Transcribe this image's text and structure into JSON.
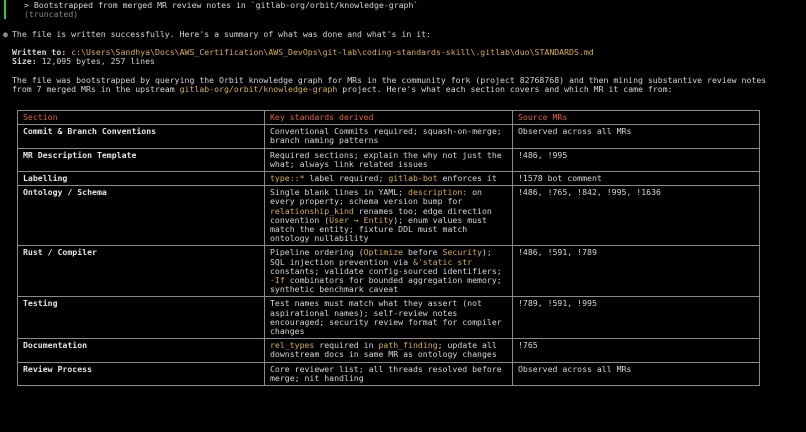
{
  "header": {
    "prompt_line": "> Bootstrapped from merged MR review notes in `gitlab-org/orbit/knowledge-graph`",
    "truncated": "(truncated)"
  },
  "summary": {
    "bullet": "●",
    "text": "The file is written successfully. Here's a summary of what was done and what's in it:"
  },
  "written": {
    "label": "Written to:",
    "path": "c:\\Users\\Sandhya\\Docs\\AWS_Certification\\AWS_DevOps\\git-lab\\coding-standards-skill\\.gitlab\\duo\\STANDARDS.md",
    "size_label": "Size:",
    "size_value": "12,095 bytes, 257 lines"
  },
  "description": {
    "line1": "The file was bootstrapped by querying the Orbit knowledge graph for MRs in the community fork (project 82768768) and then mining substantive review notes",
    "line2_pre": "from 7 merged MRs in the upstream ",
    "line2_link": "gitlab-org/orbit/knowledge-graph",
    "line2_post": " project. Here's what each section covers and which MR it came from:"
  },
  "table": {
    "headers": [
      "Section",
      "Key standards derived",
      "Source MRs"
    ],
    "rows": [
      {
        "section": "Commit & Branch Conventions",
        "standards": [
          [
            [
              "Conventional Commits required; squash-on-merge;",
              ""
            ]
          ],
          [
            [
              "branch naming patterns",
              ""
            ]
          ]
        ],
        "sources": "Observed across all MRs"
      },
      {
        "section": "MR Description Template",
        "standards": [
          [
            [
              "Required sections; explain the why not just the",
              ""
            ]
          ],
          [
            [
              "what; always link related issues",
              ""
            ]
          ]
        ],
        "sources": "!486, !995"
      },
      {
        "section": "Labelling",
        "standards": [
          [
            [
              "type::*",
              "y"
            ],
            [
              " label required; ",
              ""
            ],
            [
              "gitlab-bot",
              "y"
            ],
            [
              " enforces it",
              ""
            ]
          ]
        ],
        "sources": "!1578 bot comment"
      },
      {
        "section": "Ontology / Schema",
        "standards": [
          [
            [
              "Single blank lines in YAML; ",
              ""
            ],
            [
              "description:",
              "y"
            ],
            [
              " on",
              ""
            ]
          ],
          [
            [
              "every property; schema version bump for",
              ""
            ]
          ],
          [
            [
              "relationship_kind",
              "y"
            ],
            [
              " renames too; edge direction",
              ""
            ]
          ],
          [
            [
              "convention (",
              ""
            ],
            [
              "User → Entity",
              "y"
            ],
            [
              "); enum values must",
              ""
            ]
          ],
          [
            [
              "match the entity; fixture DDL must match",
              ""
            ]
          ],
          [
            [
              "ontology nullability",
              ""
            ]
          ]
        ],
        "sources": "!486, !765, !842, !995, !1636"
      },
      {
        "section": "Rust / Compiler",
        "standards": [
          [
            [
              "Pipeline ordering (",
              ""
            ],
            [
              "Optimize",
              "y"
            ],
            [
              " before ",
              ""
            ],
            [
              "Security",
              "y"
            ],
            [
              ");",
              ""
            ]
          ],
          [
            [
              "SQL injection prevention via ",
              ""
            ],
            [
              "&'static str",
              "y"
            ]
          ],
          [
            [
              "constants; validate config-sourced identifiers;",
              ""
            ]
          ],
          [
            [
              "-If",
              "y"
            ],
            [
              " combinators for bounded aggregation memory;",
              ""
            ]
          ],
          [
            [
              "synthetic benchmark caveat",
              ""
            ]
          ]
        ],
        "sources": "!486, !591, !789"
      },
      {
        "section": "Testing",
        "standards": [
          [
            [
              "Test names must match what they assert (not",
              ""
            ]
          ],
          [
            [
              "aspirational names); self-review notes",
              ""
            ]
          ],
          [
            [
              "encouraged; security review format for compiler",
              ""
            ]
          ],
          [
            [
              "changes",
              ""
            ]
          ]
        ],
        "sources": "!789, !591, !995"
      },
      {
        "section": "Documentation",
        "standards": [
          [
            [
              "rel_types",
              "y"
            ],
            [
              " required in ",
              ""
            ],
            [
              "path_finding",
              "y"
            ],
            [
              "; update all",
              ""
            ]
          ],
          [
            [
              "downstream docs in same MR as ontology changes",
              ""
            ]
          ]
        ],
        "sources": "!765"
      },
      {
        "section": "Review Process",
        "standards": [
          [
            [
              "Core reviewer list; all threads resolved before",
              ""
            ]
          ],
          [
            [
              "merge; nit handling",
              ""
            ]
          ]
        ],
        "sources": "Observed across all MRs"
      }
    ]
  },
  "colors": {
    "background": "#000000",
    "text": "#d6d6d6",
    "accent_yellow": "#d8b04a",
    "header_red": "#e0623b",
    "bar_green": "#2ecc40",
    "border": "#8a8a8a"
  }
}
